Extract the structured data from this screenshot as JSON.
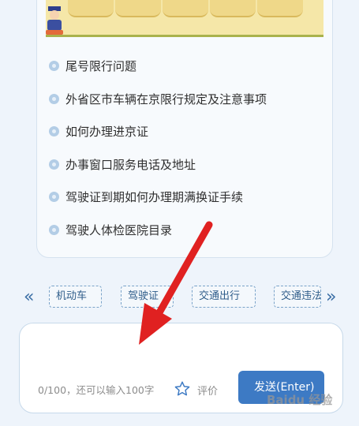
{
  "faq": {
    "items": [
      {
        "label": "尾号限行问题"
      },
      {
        "label": "外省区市车辆在京限行规定及注意事项"
      },
      {
        "label": "如何办理进京证"
      },
      {
        "label": "办事窗口服务电话及地址"
      },
      {
        "label": " 驾驶证到期如何办理期满换证手续"
      },
      {
        "label": "驾驶人体检医院目录"
      }
    ]
  },
  "categories": {
    "prev_icon": "«",
    "next_icon": "»",
    "tags": [
      {
        "label": "机动车"
      },
      {
        "label": "驾驶证"
      },
      {
        "label": "交通出行"
      },
      {
        "label": "交通违法"
      }
    ]
  },
  "composer": {
    "counter": "0/100，还可以输入100字",
    "rate_label": "评价",
    "send_label": "发送(Enter)"
  },
  "watermark": {
    "text": "Baidu 经验"
  },
  "colors": {
    "accent": "#3d7ac4",
    "arrow": "#e02121",
    "tag_border": "#7aa3c9"
  }
}
